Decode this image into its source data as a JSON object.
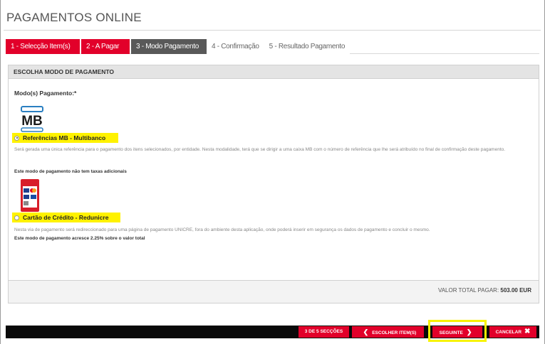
{
  "header": {
    "title": "PAGAMENTOS ONLINE"
  },
  "steps": [
    {
      "label": "1 - Selecção Item(s)",
      "state": "done"
    },
    {
      "label": "2 - A Pagar",
      "state": "done"
    },
    {
      "label": "3 - Modo Pagamento",
      "state": "active"
    },
    {
      "label": "4 - Confirmação",
      "state": "pending"
    },
    {
      "label": "5 - Resultado Pagamento",
      "state": "pending"
    }
  ],
  "panel": {
    "heading": "ESCOLHA MODO DE PAGAMENTO",
    "field_label": "Modo(s) Pagamento:*",
    "options": [
      {
        "label": "Referências MB - Multibanco",
        "selected": true,
        "icon": "multibanco-logo-icon",
        "description": "Será gerada uma única referência para o pagamento dos itens selecionados, por entidade. Nesta modalidade, terá que se dirigir a uma caixa MB com o número de referência que lhe será atribuído no final de confirmação deste pagamento.",
        "fee_note": "Este modo de pagamento não tem taxas adicionais"
      },
      {
        "label": "Cartão de Crédito - Redunicre",
        "selected": false,
        "icon": "credit-card-logo-icon",
        "description": "Nesta via de pagamento será redireccionado para uma página de pagamento UNICRE, fora do ambiente desta aplicação, onde poderá inserir em segurança os dados de pagamento e concluir o mesmo.",
        "fee_note": "Este modo de pagamento acresce 2.25% sobre o valor total"
      }
    ],
    "total_label": "VALOR TOTAL PAGAR:",
    "total_value": "503.00 EUR"
  },
  "footer": {
    "sections_label": "3 DE 5 SECÇÕES",
    "choose_label": "ESCOLHER ITEM(S)",
    "next_label": "SEGUINTE",
    "cancel_label": "CANCELAR"
  },
  "colors": {
    "accent": "#e2002a",
    "active_step": "#595959",
    "highlight": "#fff200"
  }
}
